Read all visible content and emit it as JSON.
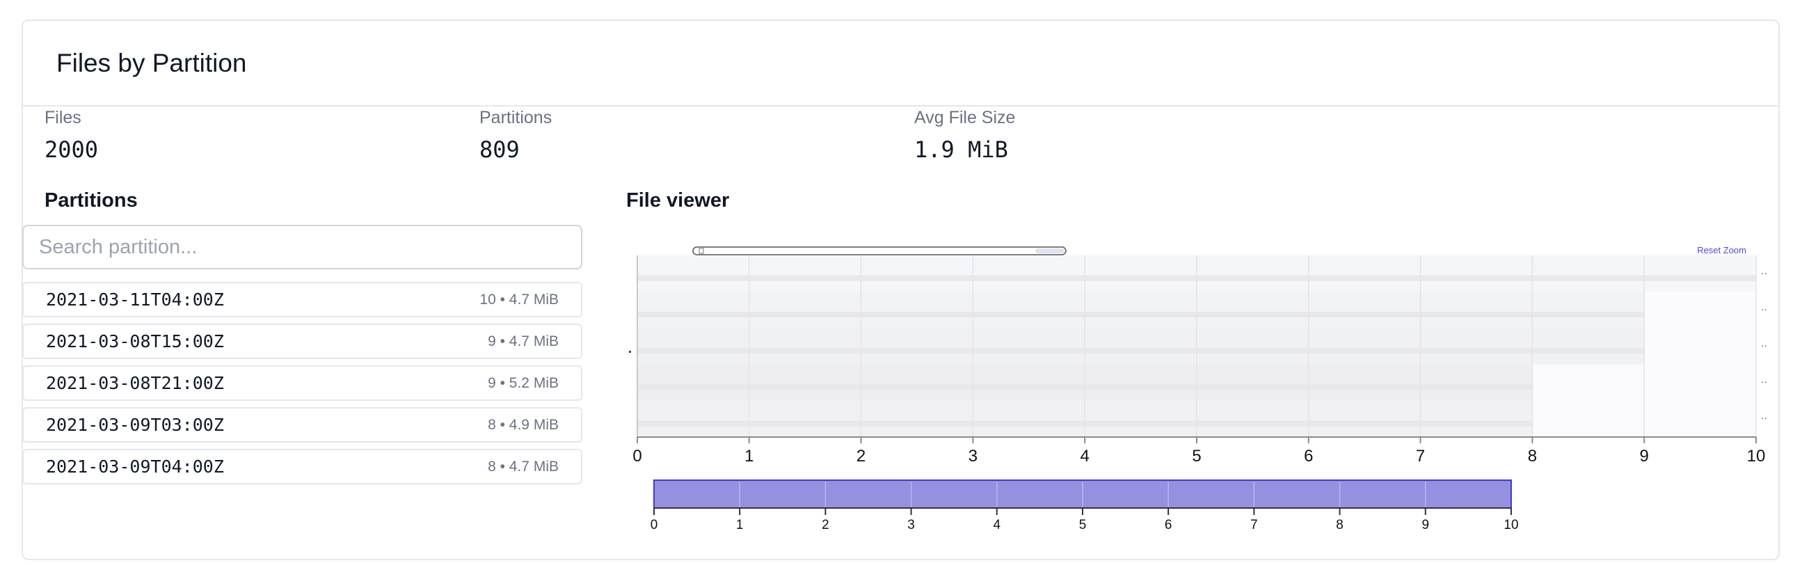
{
  "card": {
    "title": "Files by Partition"
  },
  "stats": [
    {
      "label": "Files",
      "value": "2000"
    },
    {
      "label": "Partitions",
      "value": "809"
    },
    {
      "label": "Avg File Size",
      "value": "1.9 MiB"
    }
  ],
  "partitions": {
    "title": "Partitions",
    "search_placeholder": "Search partition...",
    "items": [
      {
        "name": "2021-03-11T04:00Z",
        "files": 10,
        "size": "4.7 MiB",
        "meta": "10 • 4.7 MiB"
      },
      {
        "name": "2021-03-08T15:00Z",
        "files": 9,
        "size": "4.7 MiB",
        "meta": "9 • 4.7 MiB"
      },
      {
        "name": "2021-03-08T21:00Z",
        "files": 9,
        "size": "5.2 MiB",
        "meta": "9 • 5.2 MiB"
      },
      {
        "name": "2021-03-09T03:00Z",
        "files": 8,
        "size": "4.9 MiB",
        "meta": "8 • 4.9 MiB"
      },
      {
        "name": "2021-03-09T04:00Z",
        "files": 8,
        "size": "4.7 MiB",
        "meta": "8 • 4.7 MiB"
      }
    ]
  },
  "viewer": {
    "title": "File viewer",
    "reset_zoom_label": "Reset Zoom",
    "main_axis": {
      "ticks": [
        "0",
        "1",
        "2",
        "3",
        "4",
        "5",
        "6",
        "7",
        "8",
        "9",
        "10"
      ],
      "min": 0,
      "max": 10
    },
    "navigator_axis": {
      "ticks": [
        "0",
        "1",
        "2",
        "3",
        "4",
        "5",
        "6",
        "7",
        "8",
        "9",
        "10"
      ],
      "min": 0,
      "max": 10
    },
    "rows": [
      {
        "shade": "#f5f6fa",
        "extent": 10
      },
      {
        "shade": "#f2f3f7",
        "extent": 9
      },
      {
        "shade": "#f0f1f5",
        "extent": 9
      },
      {
        "shade": "#eeeef1",
        "extent": 8
      },
      {
        "shade": "#f1f1f3",
        "extent": 8
      }
    ],
    "colors": {
      "navigator_fill": "#9591e0",
      "navigator_stroke": "#4338ca",
      "reset_zoom": "#4f46e5"
    }
  }
}
